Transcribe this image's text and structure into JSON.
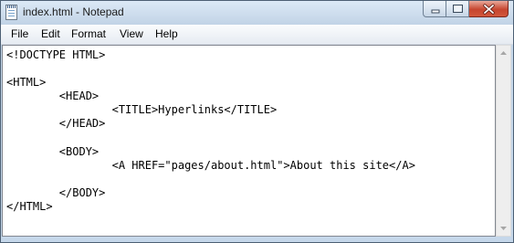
{
  "window": {
    "title": "index.html - Notepad",
    "icon": "notepad-icon"
  },
  "menu": [
    {
      "label": "File"
    },
    {
      "label": "Edit"
    },
    {
      "label": "Format"
    },
    {
      "label": "View"
    },
    {
      "label": "Help"
    }
  ],
  "editor": {
    "lines": [
      "<!DOCTYPE HTML>",
      "",
      "<HTML>",
      "        <HEAD>",
      "                <TITLE>Hyperlinks</TITLE>",
      "        </HEAD>",
      "",
      "        <BODY>",
      "                <A HREF=\"pages/about.html\">About this site</A>",
      "",
      "        </BODY>",
      "</HTML>"
    ]
  },
  "colors": {
    "frame": "#c5d7ea",
    "close_button": "#c6462f"
  }
}
